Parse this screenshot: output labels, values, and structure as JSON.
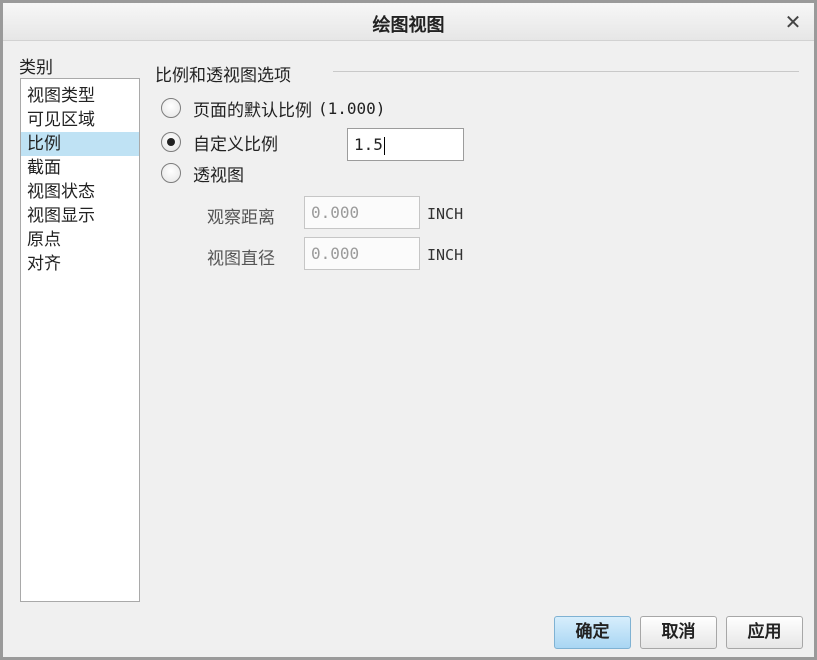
{
  "window": {
    "title": "绘图视图",
    "close_glyph": "✕"
  },
  "category": {
    "label": "类别",
    "items": [
      "视图类型",
      "可见区域",
      "比例",
      "截面",
      "视图状态",
      "视图显示",
      "原点",
      "对齐"
    ],
    "selected_index": 2
  },
  "scale_options": {
    "group_title": "比例和透视图选项",
    "radio_page_default_label": "页面的默认比例",
    "radio_page_default_value": "(1.000)",
    "radio_custom_label": "自定义比例",
    "custom_scale_value": "1.5",
    "radio_perspective_label": "透视图",
    "selected": "custom",
    "view_distance_label": "观察距离",
    "view_distance_value": "0.000",
    "view_distance_unit": "INCH",
    "view_diameter_label": "视图直径",
    "view_diameter_value": "0.000",
    "view_diameter_unit": "INCH"
  },
  "buttons": {
    "ok": "确定",
    "cancel": "取消",
    "apply": "应用"
  },
  "colors": {
    "selection": "#bfe2f4",
    "primary_button": "#a9d6f3"
  },
  "icons": {
    "close": "close-icon"
  }
}
